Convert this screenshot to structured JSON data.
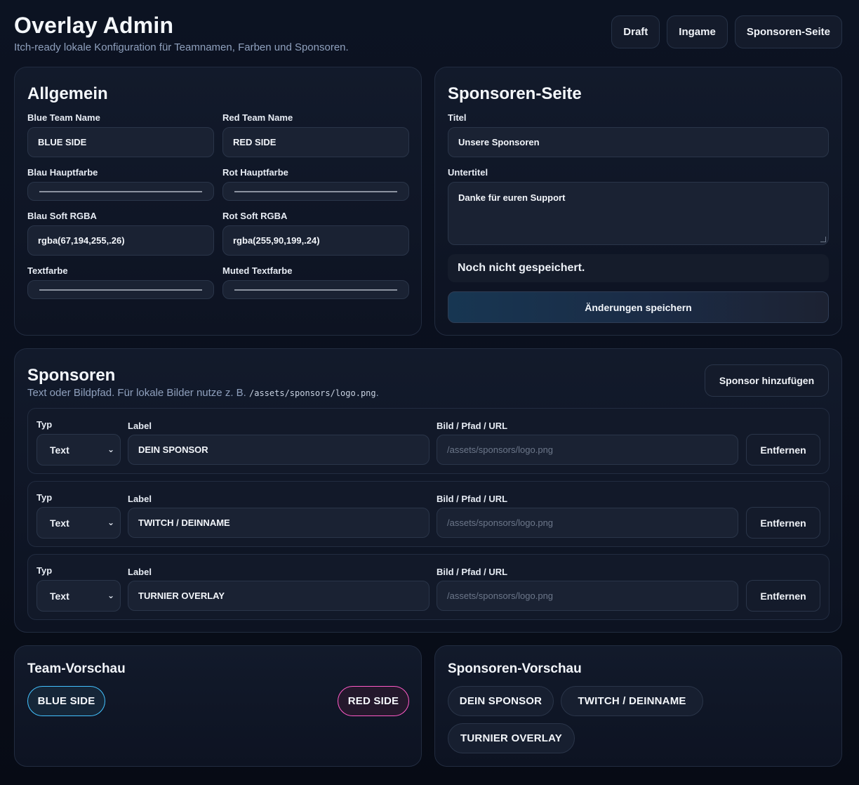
{
  "header": {
    "title": "Overlay Admin",
    "subtitle": "Itch-ready lokale Konfiguration für Teamnamen, Farben und Sponsoren.",
    "nav": [
      "Draft",
      "Ingame",
      "Sponsoren-Seite"
    ]
  },
  "general": {
    "title": "Allgemein",
    "blue_team_label": "Blue Team Name",
    "blue_team_value": "BLUE SIDE",
    "red_team_label": "Red Team Name",
    "red_team_value": "RED SIDE",
    "blue_main_label": "Blau Hauptfarbe",
    "red_main_label": "Rot Hauptfarbe",
    "blue_soft_label": "Blau Soft RGBA",
    "blue_soft_value": "rgba(67,194,255,.26)",
    "red_soft_label": "Rot Soft RGBA",
    "red_soft_value": "rgba(255,90,199,.24)",
    "text_color_label": "Textfarbe",
    "muted_color_label": "Muted Textfarbe"
  },
  "sponsor_page": {
    "title": "Sponsoren-Seite",
    "title_label": "Titel",
    "title_value": "Unsere Sponsoren",
    "subtitle_label": "Untertitel",
    "subtitle_value": "Danke für euren Support",
    "status": "Noch nicht gespeichert.",
    "save_label": "Änderungen speichern"
  },
  "sponsors": {
    "title": "Sponsoren",
    "hint_text": "Text oder Bildpfad. Für lokale Bilder nutze z. B.",
    "hint_code": "/assets/sponsors/logo.png",
    "hint_end": ".",
    "add_label": "Sponsor hinzufügen",
    "col_type": "Typ",
    "col_label": "Label",
    "col_image": "Bild / Pfad / URL",
    "image_placeholder": "/assets/sponsors/logo.png",
    "remove_label": "Entfernen",
    "rows": [
      {
        "type": "Text",
        "label": "DEIN SPONSOR"
      },
      {
        "type": "Text",
        "label": "TWITCH / DEINNAME"
      },
      {
        "type": "Text",
        "label": "TURNIER OVERLAY"
      }
    ]
  },
  "team_preview": {
    "title": "Team-Vorschau",
    "blue": "BLUE SIDE",
    "red": "RED SIDE"
  },
  "sponsor_preview": {
    "title": "Sponsoren-Vorschau",
    "items": [
      "DEIN SPONSOR",
      "TWITCH / DEINNAME",
      "TURNIER OVERLAY"
    ]
  },
  "colors": {
    "blue_accent": "#43c2ff",
    "red_accent": "#ff5ac7",
    "background": "#0a0f1c"
  }
}
